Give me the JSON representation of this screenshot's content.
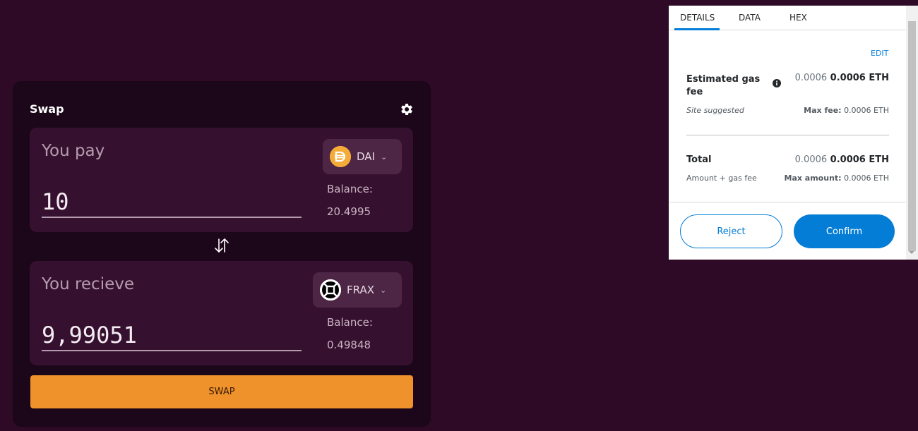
{
  "swap": {
    "title": "Swap",
    "pay": {
      "label": "You pay",
      "amount": "10",
      "token": "DAI",
      "balance_label": "Balance:",
      "balance_value": "20.4995"
    },
    "receive": {
      "label": "You recieve",
      "amount": "9,99051",
      "token": "FRAX",
      "balance_label": "Balance:",
      "balance_value": "0.49848"
    },
    "swap_button": "SWAP"
  },
  "popup": {
    "tabs": [
      "DETAILS",
      "DATA",
      "HEX"
    ],
    "edit": "EDIT",
    "gas": {
      "label": "Estimated gas fee",
      "value_light": "0.0006",
      "value_bold": "0.0006 ETH",
      "sub_left": "Site suggested",
      "max_label": "Max fee:",
      "max_value": "0.0006 ETH"
    },
    "total": {
      "label": "Total",
      "value_light": "0.0006",
      "value_bold": "0.0006 ETH",
      "sub_left": "Amount + gas fee",
      "max_label": "Max amount:",
      "max_value": "0.0006 ETH"
    },
    "reject": "Reject",
    "confirm": "Confirm"
  },
  "colors": {
    "background": "#2e0a26",
    "accent_orange": "#ef922b",
    "metamask_blue": "#037dd6"
  },
  "icons": [
    "gear-icon",
    "swap-arrows-icon",
    "dai-icon",
    "frax-icon",
    "chevron-down-icon",
    "info-icon"
  ]
}
